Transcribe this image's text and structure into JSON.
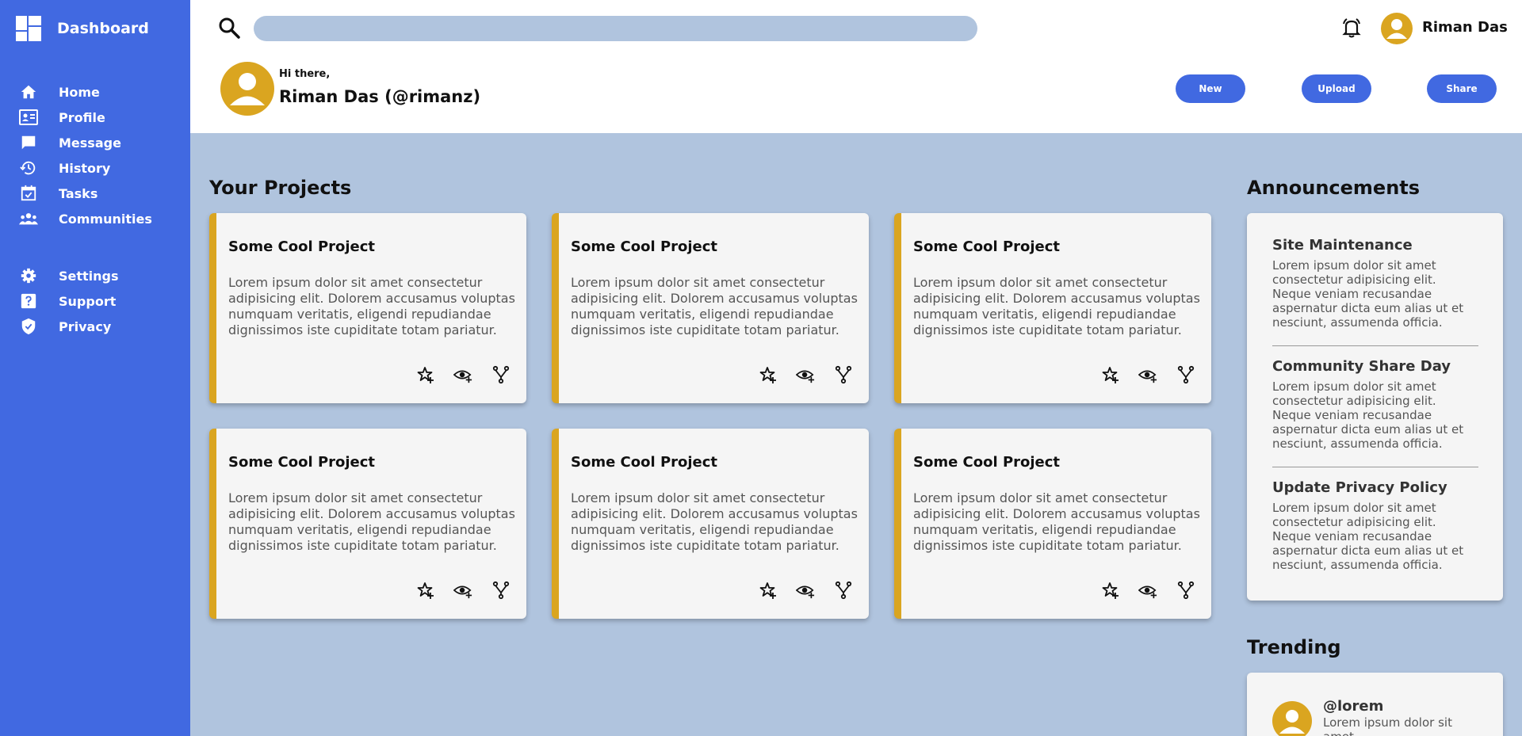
{
  "sidebar": {
    "brand": "Dashboard",
    "items": [
      {
        "label": "Home",
        "icon": "home-icon"
      },
      {
        "label": "Profile",
        "icon": "id-card-icon"
      },
      {
        "label": "Message",
        "icon": "chat-icon"
      },
      {
        "label": "History",
        "icon": "history-icon"
      },
      {
        "label": "Tasks",
        "icon": "calendar-check-icon"
      },
      {
        "label": "Communities",
        "icon": "people-icon"
      }
    ],
    "secondary": [
      {
        "label": "Settings",
        "icon": "gear-icon"
      },
      {
        "label": "Support",
        "icon": "help-icon"
      },
      {
        "label": "Privacy",
        "icon": "shield-icon"
      }
    ]
  },
  "header": {
    "search_placeholder": "",
    "user_name": "Riman Das",
    "greeting": "Hi there,",
    "full_name": "Riman Das (@rimanz)",
    "buttons": {
      "new": "New",
      "upload": "Upload",
      "share": "Share"
    }
  },
  "projects": {
    "title": "Your Projects",
    "items": [
      {
        "title": "Some Cool Project",
        "description": "Lorem ipsum dolor sit amet consectetur adipisicing elit. Dolorem accusamus voluptas numquam veritatis, eligendi repudiandae dignissimos iste cupiditate totam pariatur."
      },
      {
        "title": "Some Cool Project",
        "description": "Lorem ipsum dolor sit amet consectetur adipisicing elit. Dolorem accusamus voluptas numquam veritatis, eligendi repudiandae dignissimos iste cupiditate totam pariatur."
      },
      {
        "title": "Some Cool Project",
        "description": "Lorem ipsum dolor sit amet consectetur adipisicing elit. Dolorem accusamus voluptas numquam veritatis, eligendi repudiandae dignissimos iste cupiditate totam pariatur."
      },
      {
        "title": "Some Cool Project",
        "description": "Lorem ipsum dolor sit amet consectetur adipisicing elit. Dolorem accusamus voluptas numquam veritatis, eligendi repudiandae dignissimos iste cupiditate totam pariatur."
      },
      {
        "title": "Some Cool Project",
        "description": "Lorem ipsum dolor sit amet consectetur adipisicing elit. Dolorem accusamus voluptas numquam veritatis, eligendi repudiandae dignissimos iste cupiditate totam pariatur."
      },
      {
        "title": "Some Cool Project",
        "description": "Lorem ipsum dolor sit amet consectetur adipisicing elit. Dolorem accusamus voluptas numquam veritatis, eligendi repudiandae dignissimos iste cupiditate totam pariatur."
      }
    ],
    "action_icons": [
      "star-add-icon",
      "eye-add-icon",
      "fork-icon"
    ]
  },
  "announcements": {
    "title": "Announcements",
    "items": [
      {
        "title": "Site Maintenance",
        "text": "Lorem ipsum dolor sit amet consectetur adipisicing elit. Neque veniam recusandae aspernatur dicta eum alias ut et nesciunt, assumenda officia."
      },
      {
        "title": "Community Share Day",
        "text": "Lorem ipsum dolor sit amet consectetur adipisicing elit. Neque veniam recusandae aspernatur dicta eum alias ut et nesciunt, assumenda officia."
      },
      {
        "title": "Update Privacy Policy",
        "text": "Lorem ipsum dolor sit amet consectetur adipisicing elit. Neque veniam recusandae aspernatur dicta eum alias ut et nesciunt, assumenda officia."
      }
    ]
  },
  "trending": {
    "title": "Trending",
    "items": [
      {
        "handle": "@lorem",
        "text": "Lorem ipsum dolor sit amet"
      }
    ]
  },
  "colors": {
    "sidebar": "#4169e1",
    "accent": "#daa520",
    "background": "#b0c4de",
    "card": "#f5f5f5"
  }
}
